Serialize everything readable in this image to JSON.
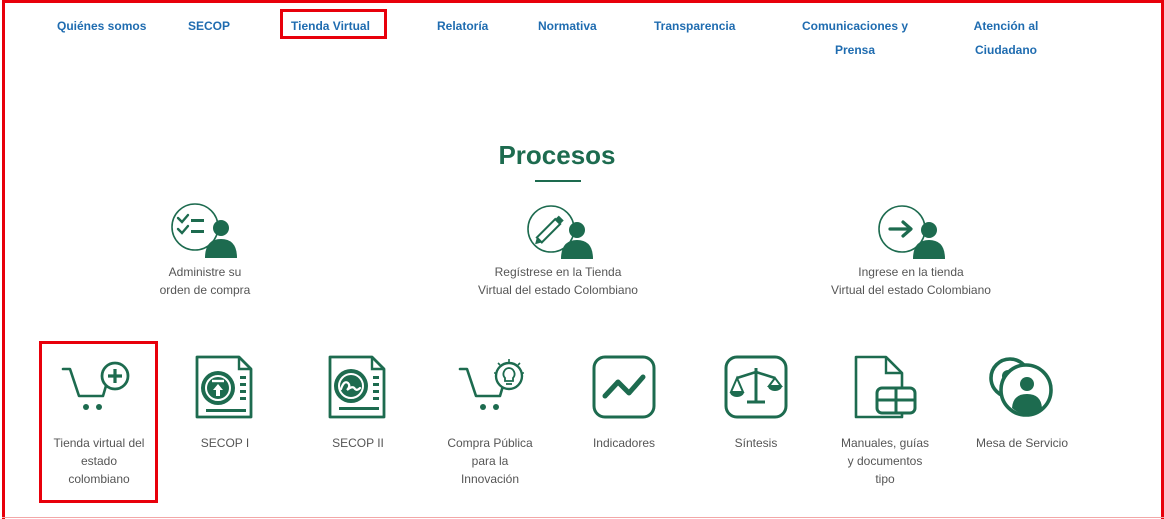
{
  "nav": {
    "items": [
      {
        "label": "Quiénes somos"
      },
      {
        "label": "SECOP"
      },
      {
        "label": "Tienda Virtual"
      },
      {
        "label": "Relatoría"
      },
      {
        "label": "Normativa"
      },
      {
        "label": "Transparencia"
      },
      {
        "label": "Comunicaciones y",
        "label2": "Prensa"
      },
      {
        "label": "Atención al",
        "label2": "Ciudadano"
      }
    ]
  },
  "section": {
    "title": "Procesos"
  },
  "top_processes": [
    {
      "line1": "Administre su",
      "line2": "orden de compra",
      "icon": "checklist-user-icon"
    },
    {
      "line1": "Regístrese en la Tienda",
      "line2": "Virtual del estado Colombiano",
      "icon": "pencil-user-icon"
    },
    {
      "line1": "Ingrese en la tienda",
      "line2": "Virtual del estado Colombiano",
      "icon": "arrow-user-icon"
    }
  ],
  "services": [
    {
      "lines": [
        "Tienda virtual del",
        "estado",
        "colombiano"
      ],
      "icon": "cart-plus-icon"
    },
    {
      "lines": [
        "SECOP I"
      ],
      "icon": "document-upload-icon"
    },
    {
      "lines": [
        "SECOP II"
      ],
      "icon": "document-signature-icon"
    },
    {
      "lines": [
        "Compra Pública",
        "para la",
        "Innovación"
      ],
      "icon": "cart-lightbulb-icon"
    },
    {
      "lines": [
        "Indicadores"
      ],
      "icon": "line-chart-icon"
    },
    {
      "lines": [
        "Síntesis"
      ],
      "icon": "scales-icon"
    },
    {
      "lines": [
        "Manuales, guías",
        "y documentos",
        "tipo"
      ],
      "icon": "document-grid-icon"
    },
    {
      "lines": [
        "Mesa de Servicio"
      ],
      "icon": "support-user-icon"
    }
  ],
  "colors": {
    "nav_link": "#1f6cb0",
    "brand_green": "#1d6b4f",
    "highlight_red": "#e8000b",
    "body_text": "#555555"
  }
}
